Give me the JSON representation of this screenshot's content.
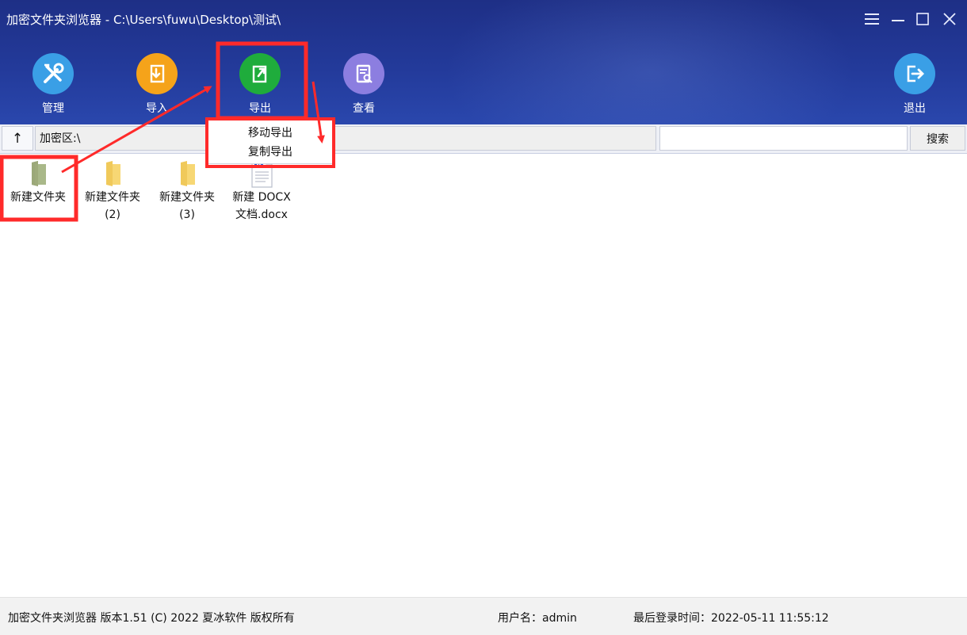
{
  "window": {
    "title": "加密文件夹浏览器 - C:\\Users\\fuwu\\Desktop\\测试\\"
  },
  "toolbar": {
    "manage_label": "管理",
    "import_label": "导入",
    "export_label": "导出",
    "view_label": "查看",
    "logout_label": "退出"
  },
  "addressbar": {
    "up_label": "↑",
    "path": "加密区:\\",
    "search_value": "",
    "search_label": "搜索"
  },
  "export_menu": {
    "items": [
      {
        "label": "移动导出"
      },
      {
        "label": "复制导出"
      }
    ]
  },
  "files": [
    {
      "name_line1": "新建文件夹",
      "name_line2": "",
      "type": "folder",
      "selected": true
    },
    {
      "name_line1": "新建文件夹",
      "name_line2": "(2)",
      "type": "folder",
      "selected": false
    },
    {
      "name_line1": "新建文件夹",
      "name_line2": "(3)",
      "type": "folder",
      "selected": false
    },
    {
      "name_line1": "新建 DOCX",
      "name_line2": "文档.docx",
      "type": "docx",
      "selected": false
    }
  ],
  "status": {
    "app_info": "加密文件夹浏览器 版本1.51 (C) 2022 夏冰软件 版权所有",
    "user": "用户名：admin",
    "last_login": "最后登录时间：2022-05-11 11:55:12"
  },
  "colors": {
    "header": "#233a9a",
    "manage": "#3a9fe6",
    "import": "#f5a31a",
    "export": "#1fac3c",
    "view": "#8c7ee0",
    "logout": "#3a9fe6",
    "annotation": "#ff2a2a"
  }
}
